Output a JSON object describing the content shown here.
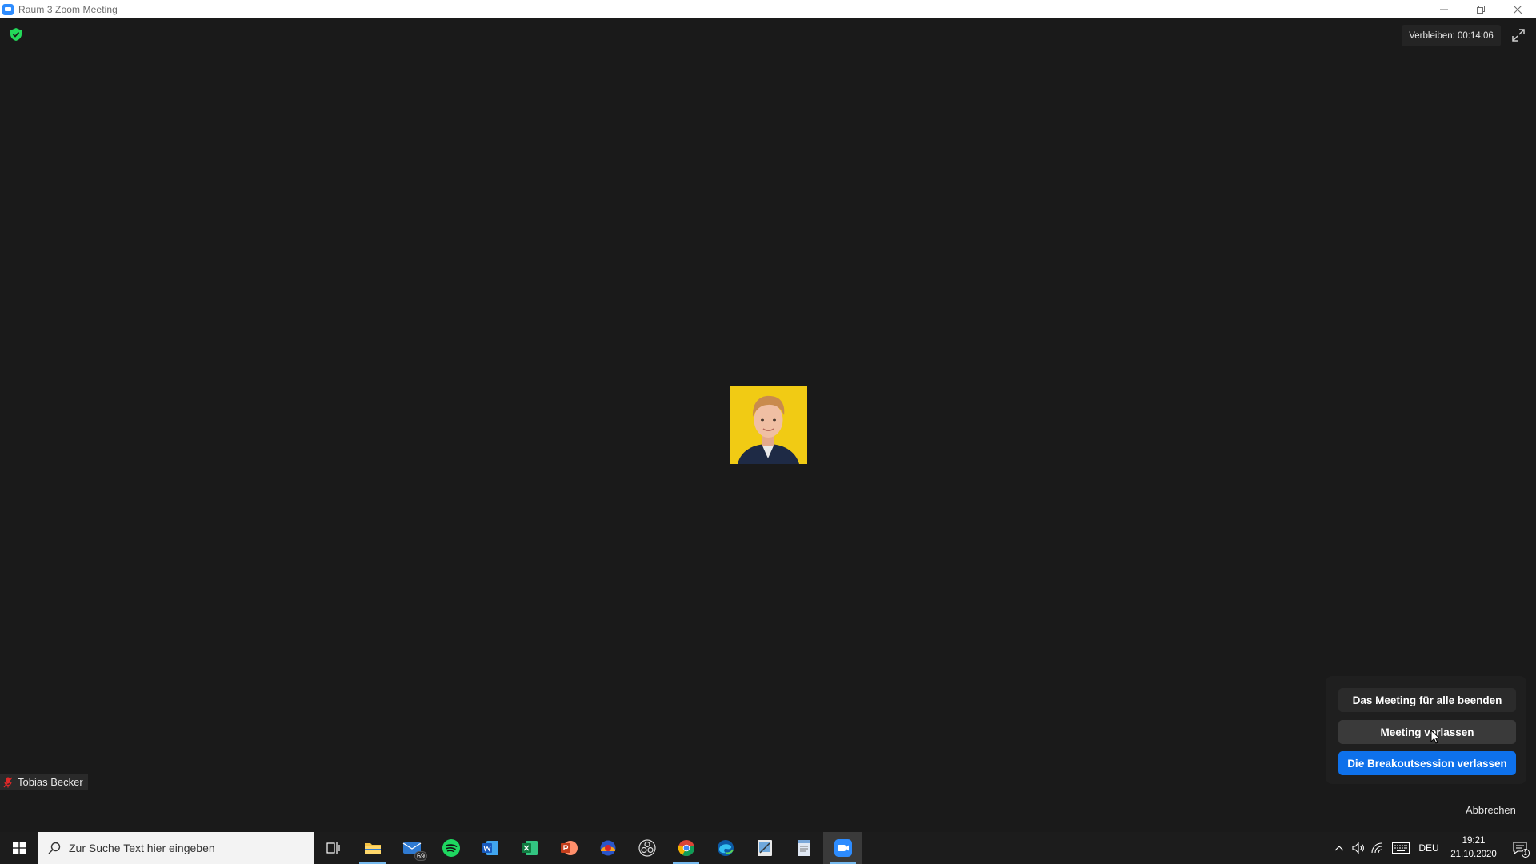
{
  "window": {
    "title": "Raum 3   Zoom Meeting"
  },
  "meeting": {
    "timer_text": "Verbleiben: 00:14:06",
    "participant_name": "Tobias Becker"
  },
  "popup": {
    "end_all_label": "Das Meeting für alle beenden",
    "leave_label": "Meeting verlassen",
    "leave_breakout_label": "Die Breakoutsession verlassen",
    "cancel_label": "Abbrechen"
  },
  "taskbar": {
    "search_placeholder": "Zur Suche Text hier eingeben",
    "mail_badge": "69",
    "language": "DEU",
    "time": "19:21",
    "date": "21.10.2020",
    "notification_count": "1"
  },
  "colors": {
    "background": "#1a1a1a",
    "primary_button": "#0e71eb",
    "avatar_bg": "#f1cb14",
    "taskbar": "#1c1c1c"
  }
}
